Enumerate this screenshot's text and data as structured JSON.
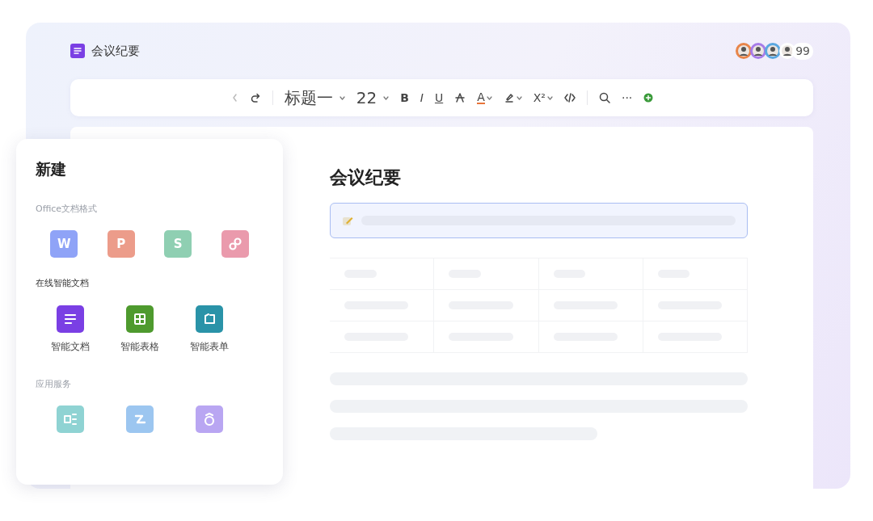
{
  "header": {
    "title": "会议纪要",
    "avatars": [
      {
        "color": "#e8854a"
      },
      {
        "color": "#a77be8"
      },
      {
        "color": "#5aa7e0"
      },
      {
        "color": "#ffffff"
      }
    ],
    "count": "99"
  },
  "toolbar": [
    {
      "kind": "back"
    },
    {
      "kind": "redo"
    },
    {
      "kind": "sep"
    },
    {
      "kind": "select",
      "label": "标题一",
      "caret": true
    },
    {
      "kind": "select",
      "label": "22",
      "caret": true
    },
    {
      "kind": "bold",
      "label": "B",
      "caret": false
    },
    {
      "kind": "italic",
      "label": "I",
      "caret": false
    },
    {
      "kind": "underline",
      "label": "U",
      "caret": false
    },
    {
      "kind": "strike"
    },
    {
      "kind": "fontcolor",
      "label": "A",
      "caret": true
    },
    {
      "kind": "highlight",
      "caret": true
    },
    {
      "kind": "super",
      "label": "X²",
      "caret": true
    },
    {
      "kind": "code"
    },
    {
      "kind": "sep"
    },
    {
      "kind": "search"
    },
    {
      "kind": "more",
      "label": "···",
      "caret": false
    },
    {
      "kind": "add"
    }
  ],
  "document": {
    "title": "会议纪要"
  },
  "new_panel": {
    "title": "新建",
    "sections": [
      {
        "title": "Office文档格式",
        "disabled": true,
        "items": [
          {
            "kind": "letter",
            "letter": "W",
            "color": "#8fa3f7"
          },
          {
            "kind": "letter",
            "letter": "P",
            "color": "#ec9c8a"
          },
          {
            "kind": "letter",
            "letter": "S",
            "color": "#8fcfb2"
          },
          {
            "kind": "link",
            "color": "#ea9aac"
          }
        ]
      },
      {
        "title": "在线智能文档",
        "disabled": false,
        "items": [
          {
            "kind": "doc",
            "color": "#7a3fe4",
            "label": "智能文档"
          },
          {
            "kind": "grid",
            "color": "#4e9a2e",
            "label": "智能表格"
          },
          {
            "kind": "form",
            "color": "#2a93a8",
            "label": "智能表单"
          }
        ]
      },
      {
        "title": "应用服务",
        "disabled": true,
        "items": [
          {
            "kind": "flow",
            "color": "#8fd3d3"
          },
          {
            "kind": "swirl",
            "color": "#9cc6f0"
          },
          {
            "kind": "bot",
            "color": "#b9a6f2"
          }
        ]
      }
    ]
  }
}
